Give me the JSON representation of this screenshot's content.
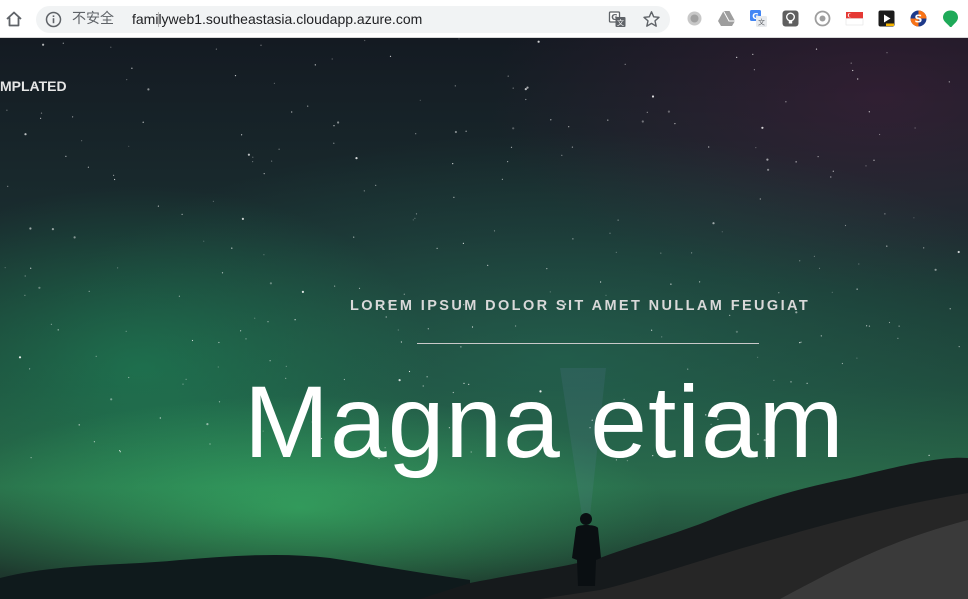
{
  "browser": {
    "security_label": "不安全",
    "url": "familyweb1.southeastasia.cloudapp.azure.com",
    "extension_icons": [
      "grey-circle-extension-icon",
      "drive-icon",
      "google-translate-extension-icon",
      "lightbulb-extension-icon",
      "eye-extension-icon",
      "singapore-flag-icon",
      "play-extension-icon",
      "s-logo-extension-icon",
      "green-pin-extension-icon"
    ]
  },
  "site": {
    "logo_text": "MPLATED",
    "subtitle": "LOREM IPSUM DOLOR SIT AMET NULLAM FEUGIAT",
    "headline": "Magna etiam"
  }
}
